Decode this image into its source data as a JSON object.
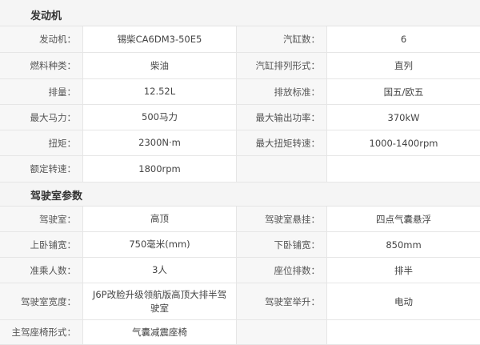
{
  "engine": {
    "title": "发动机",
    "rows": [
      {
        "l1": "发动机：",
        "v1": "锡柴CA6DM3-50E5",
        "l2": "汽缸数：",
        "v2": "6"
      },
      {
        "l1": "燃料种类：",
        "v1": "柴油",
        "l2": "汽缸排列形式：",
        "v2": "直列"
      },
      {
        "l1": "排量：",
        "v1": "12.52L",
        "l2": "排放标准：",
        "v2": "国五/欧五"
      },
      {
        "l1": "最大马力：",
        "v1": "500马力",
        "l2": "最大输出功率：",
        "v2": "370kW"
      },
      {
        "l1": "扭矩：",
        "v1": "2300N·m",
        "l2": "最大扭矩转速：",
        "v2": "1000-1400rpm"
      },
      {
        "l1": "额定转速：",
        "v1": "1800rpm",
        "l2": "",
        "v2": ""
      }
    ]
  },
  "cab": {
    "title": "驾驶室参数",
    "rows": [
      {
        "l1": "驾驶室：",
        "v1": "高顶",
        "l2": "驾驶室悬挂：",
        "v2": "四点气囊悬浮"
      },
      {
        "l1": "上卧铺宽：",
        "v1": "750毫米(mm)",
        "l2": "下卧铺宽：",
        "v2": "850mm"
      },
      {
        "l1": "准乘人数：",
        "v1": "3人",
        "l2": "座位排数：",
        "v2": "排半"
      },
      {
        "l1": "驾驶室宽度：",
        "v1": "J6P改脸升级领航版高顶大排半驾驶室",
        "l2": "驾驶室举升：",
        "v2": "电动"
      },
      {
        "l1": "主驾座椅形式：",
        "v1": "气囊减震座椅",
        "l2": "",
        "v2": ""
      }
    ]
  }
}
